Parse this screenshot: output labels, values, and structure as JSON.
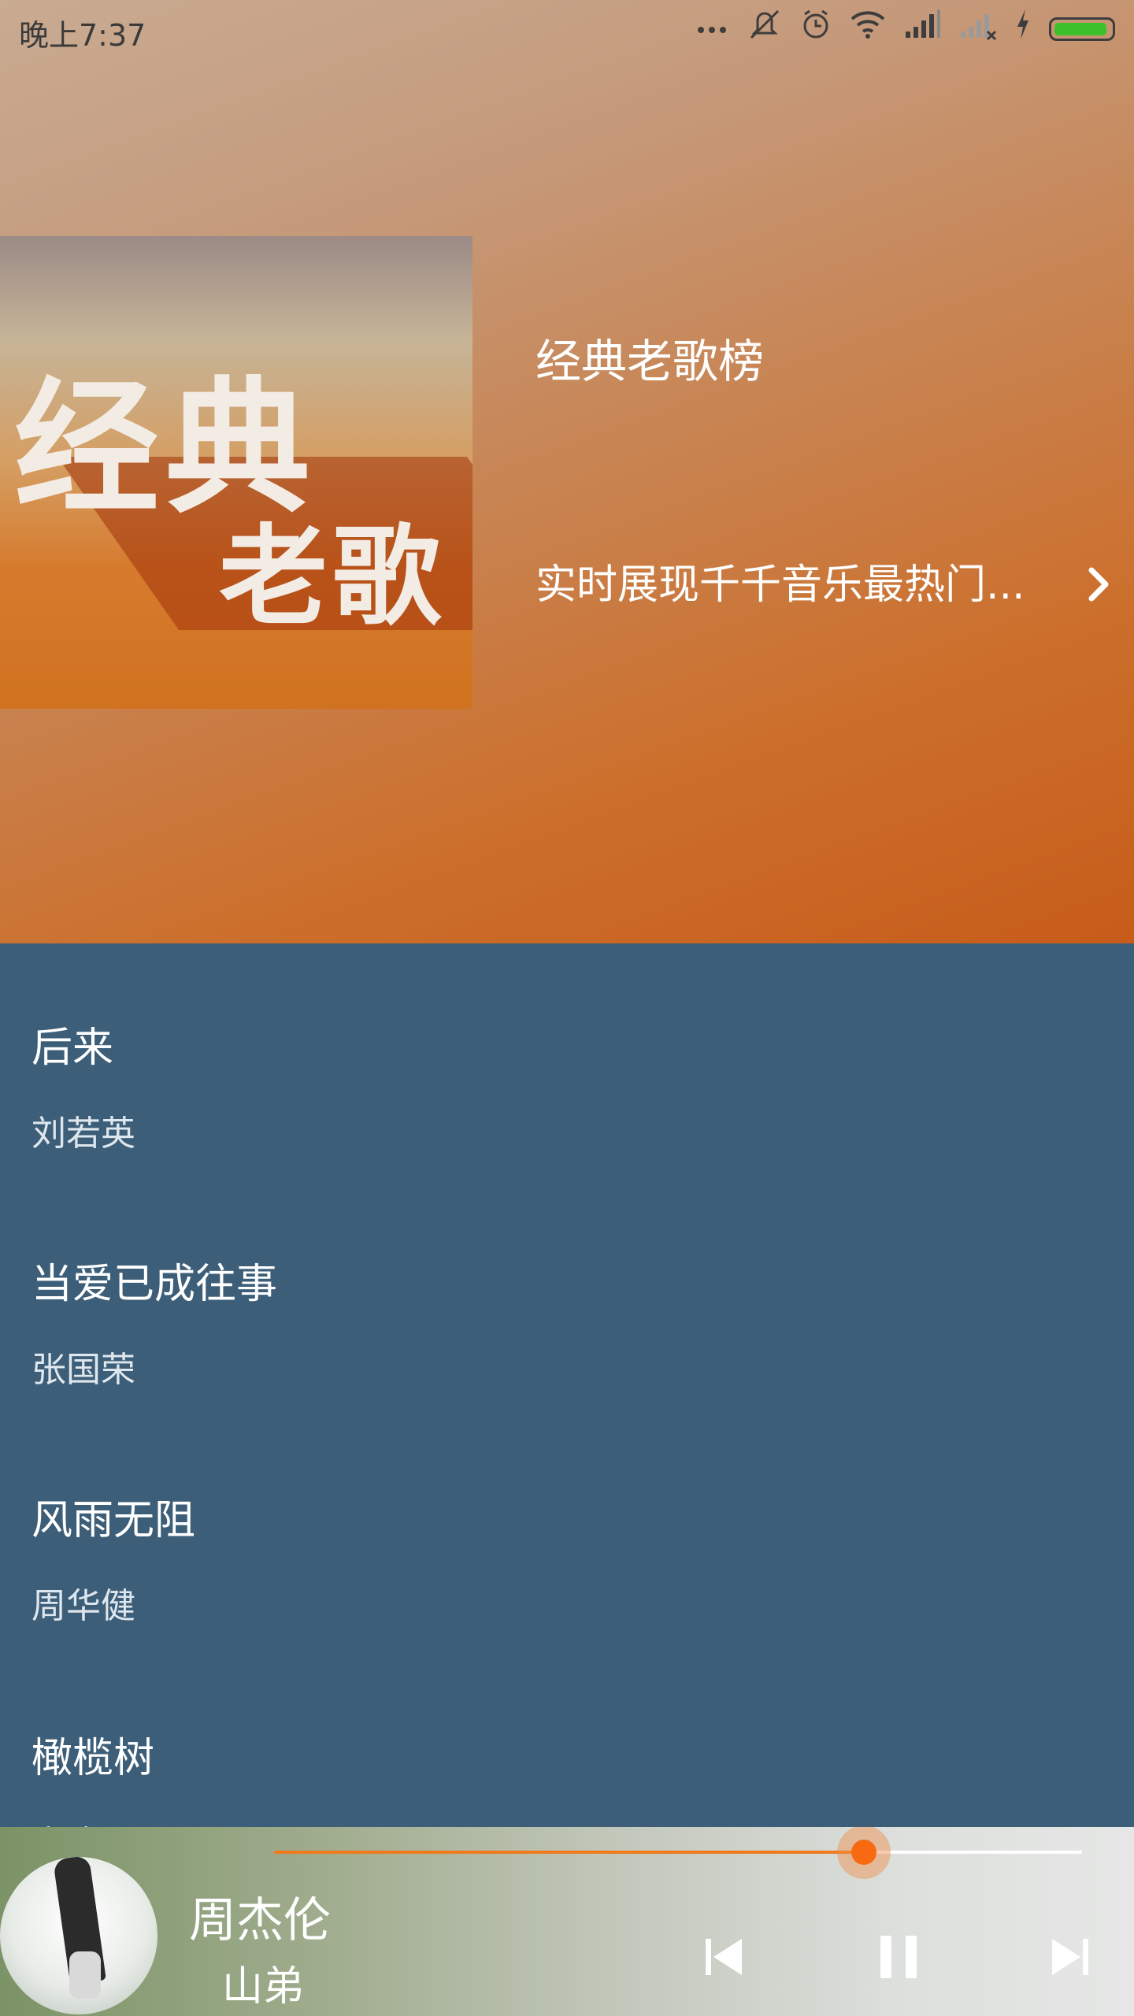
{
  "status_bar": {
    "time": "晚上7:37",
    "icons": [
      "more-dots-icon",
      "mute-vibrate-icon",
      "alarm-icon",
      "wifi-icon",
      "signal-icon",
      "signal-off-icon",
      "charging-icon",
      "battery-icon"
    ],
    "battery_color": "#3cc12b"
  },
  "header": {
    "cover_text_line1": "经典",
    "cover_text_line2": "老歌",
    "title": "经典老歌榜",
    "description": "实时展现千千音乐最热门...",
    "chevron_icon": "chevron-right-icon"
  },
  "songs": [
    {
      "title": "后来",
      "artist": "刘若英"
    },
    {
      "title": "当爱已成往事",
      "artist": "张国荣"
    },
    {
      "title": "风雨无阻",
      "artist": "周华健"
    },
    {
      "title": "橄榄树",
      "artist": "齐豫"
    }
  ],
  "player": {
    "artist": "周杰伦",
    "song": "山弟",
    "progress": 0.73,
    "controls": [
      "previous-icon",
      "pause-icon",
      "next-icon"
    ],
    "accent_color": "#f76a12"
  },
  "colors": {
    "list_background": "#3c5e78"
  }
}
